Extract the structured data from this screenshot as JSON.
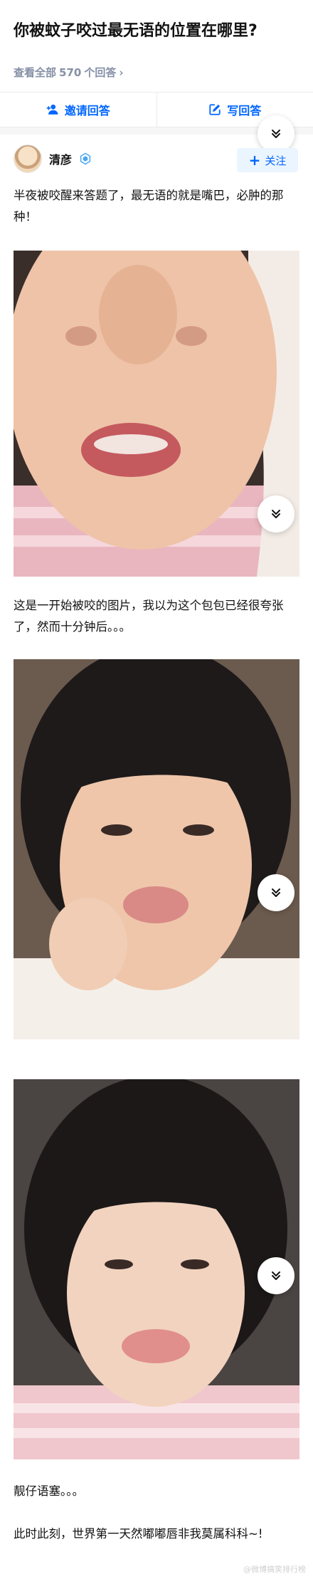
{
  "question": {
    "title": "你被蚊子咬过最无语的位置在哪里?",
    "meta_prefix": "查看全部",
    "answer_count": "570",
    "meta_suffix": "个回答",
    "meta_chevron": "›"
  },
  "actions": {
    "invite_label": "邀请回答",
    "write_label": "写回答"
  },
  "author": {
    "name": "清彦",
    "follow_label": "关注",
    "follow_plus": "+"
  },
  "answer": {
    "paragraph_1": "半夜被咬醒来答题了，最无语的就是嘴巴，必肿的那种！",
    "paragraph_2": "这是一开始被咬的图片，我以为这个包包已经很夸张了，然而十分钟后。。。",
    "paragraph_3": "靓仔语塞。。。",
    "paragraph_4": "此时此刻，世界第一天然嘟嘟唇非我莫属科科~!"
  },
  "watermark": "@微博搞笑排行榜",
  "icons": {
    "invite": "person-plus-icon",
    "write": "pen-square-icon",
    "expand": "double-chevron-down-icon",
    "badge": "verified-hexagon-icon"
  },
  "colors": {
    "accent": "#0066ff",
    "follow_bg": "#ebf5ff",
    "meta_gray": "#8590a6"
  }
}
